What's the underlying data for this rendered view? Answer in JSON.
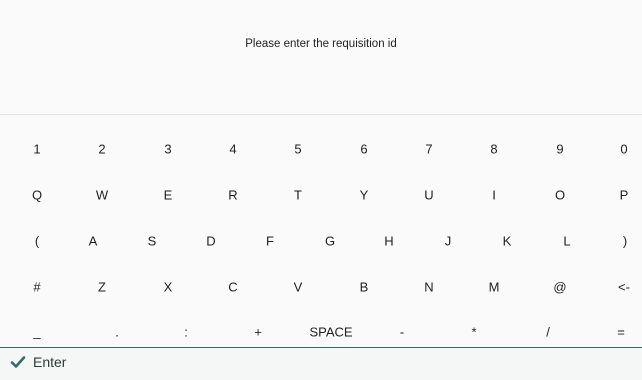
{
  "prompt": {
    "text": "Please enter the requisition id"
  },
  "keyboard": {
    "rows": [
      [
        "1",
        "2",
        "3",
        "4",
        "5",
        "6",
        "7",
        "8",
        "9",
        "0"
      ],
      [
        "Q",
        "W",
        "E",
        "R",
        "T",
        "Y",
        "U",
        "I",
        "O",
        "P"
      ],
      [
        "(",
        "A",
        "S",
        "D",
        "F",
        "G",
        "H",
        "J",
        "K",
        "L",
        ")"
      ],
      [
        "#",
        "Z",
        "X",
        "C",
        "V",
        "B",
        "N",
        "M",
        "@",
        "<-"
      ],
      [
        "_",
        ".",
        ":",
        "+",
        "SPACE",
        "-",
        "*",
        "/",
        "="
      ]
    ]
  },
  "enter": {
    "label": "Enter",
    "icon": "check-icon"
  },
  "colors": {
    "accent": "#2e6e67",
    "background": "#fafafa"
  }
}
